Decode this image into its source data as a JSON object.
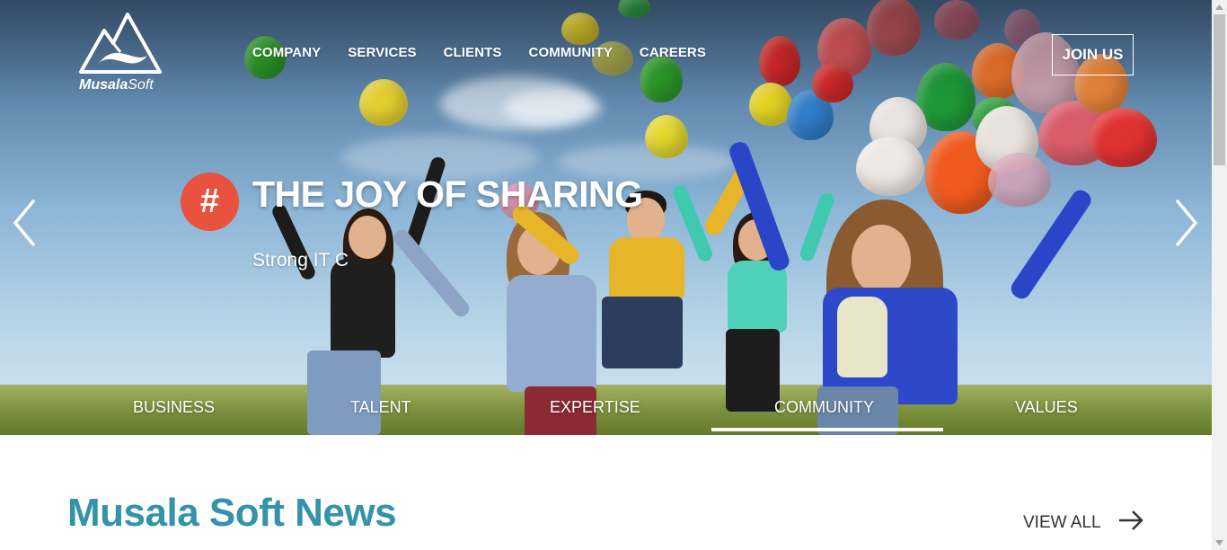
{
  "brand": {
    "name_bold": "Musala",
    "name_light": "Soft"
  },
  "nav": {
    "items": [
      {
        "label": "COMPANY"
      },
      {
        "label": "SERVICES"
      },
      {
        "label": "CLIENTS"
      },
      {
        "label": "COMMUNITY"
      },
      {
        "label": "CAREERS"
      }
    ],
    "join_label": "JOIN US"
  },
  "slide": {
    "badge": "#",
    "title": "THE JOY OF SHARING",
    "subtitle": "Strong IT C"
  },
  "tabs": {
    "items": [
      {
        "label": "BUSINESS"
      },
      {
        "label": "TALENT"
      },
      {
        "label": "EXPERTISE"
      },
      {
        "label": "COMMUNITY"
      },
      {
        "label": "VALUES"
      }
    ],
    "active": "COMMUNITY"
  },
  "news": {
    "title": "Musala Soft News",
    "view_all_label": "VIEW ALL"
  },
  "colors": {
    "accent_teal": "#3493a8",
    "badge_red": "#e8523f",
    "text_dark": "#333333"
  },
  "icons": {
    "prev": "chevron-left-icon",
    "next": "chevron-right-icon",
    "view_all": "arrow-right-icon",
    "logo": "mountain-logo-icon"
  }
}
